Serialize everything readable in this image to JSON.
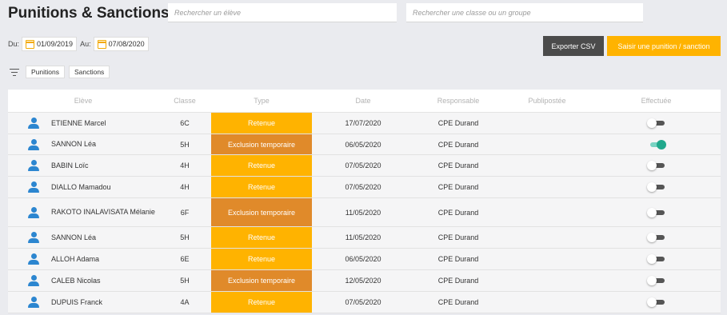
{
  "header": {
    "title": "Punitions & Sanctions",
    "search_student_placeholder": "Rechercher un élève",
    "search_class_placeholder": "Rechercher une classe ou un groupe"
  },
  "dates": {
    "from_label": "Du:",
    "from_value": "01/09/2019",
    "to_label": "Au:",
    "to_value": "07/08/2020"
  },
  "actions": {
    "export_label": "Exporter CSV",
    "add_label": "Saisir une punition / sanction"
  },
  "filters": {
    "tags": [
      "Punitions",
      "Sanctions"
    ]
  },
  "table": {
    "columns": [
      "Elève",
      "Classe",
      "Type",
      "Date",
      "Responsable",
      "Publipostée",
      "Effectuée"
    ],
    "rows": [
      {
        "name": "ETIENNE Marcel",
        "classe": "6C",
        "type": "Retenue",
        "date": "17/07/2020",
        "responsable": "CPE Durand",
        "effectuee": false
      },
      {
        "name": "SANNON Léa",
        "classe": "5H",
        "type": "Exclusion temporaire",
        "date": "06/05/2020",
        "responsable": "CPE Durand",
        "effectuee": true
      },
      {
        "name": "BABIN Loïc",
        "classe": "4H",
        "type": "Retenue",
        "date": "07/05/2020",
        "responsable": "CPE Durand",
        "effectuee": false
      },
      {
        "name": "DIALLO Mamadou",
        "classe": "4H",
        "type": "Retenue",
        "date": "07/05/2020",
        "responsable": "CPE Durand",
        "effectuee": false
      },
      {
        "name": "RAKOTO INALAVISATA Mélanie",
        "classe": "6F",
        "type": "Exclusion temporaire",
        "date": "11/05/2020",
        "responsable": "CPE Durand",
        "effectuee": false
      },
      {
        "name": "SANNON Léa",
        "classe": "5H",
        "type": "Retenue",
        "date": "11/05/2020",
        "responsable": "CPE Durand",
        "effectuee": false
      },
      {
        "name": "ALLOH Adama",
        "classe": "6E",
        "type": "Retenue",
        "date": "06/05/2020",
        "responsable": "CPE Durand",
        "effectuee": false
      },
      {
        "name": "CALEB Nicolas",
        "classe": "5H",
        "type": "Exclusion temporaire",
        "date": "12/05/2020",
        "responsable": "CPE Durand",
        "effectuee": false
      },
      {
        "name": "DUPUIS Franck",
        "classe": "4A",
        "type": "Retenue",
        "date": "07/05/2020",
        "responsable": "CPE Durand",
        "effectuee": false
      }
    ]
  },
  "colors": {
    "retenue": "#ffb300",
    "exclusion": "#e08a2a",
    "toggle_on": "#20a88c",
    "avatar": "#2c86d0",
    "export_button": "#4b4b4b"
  }
}
